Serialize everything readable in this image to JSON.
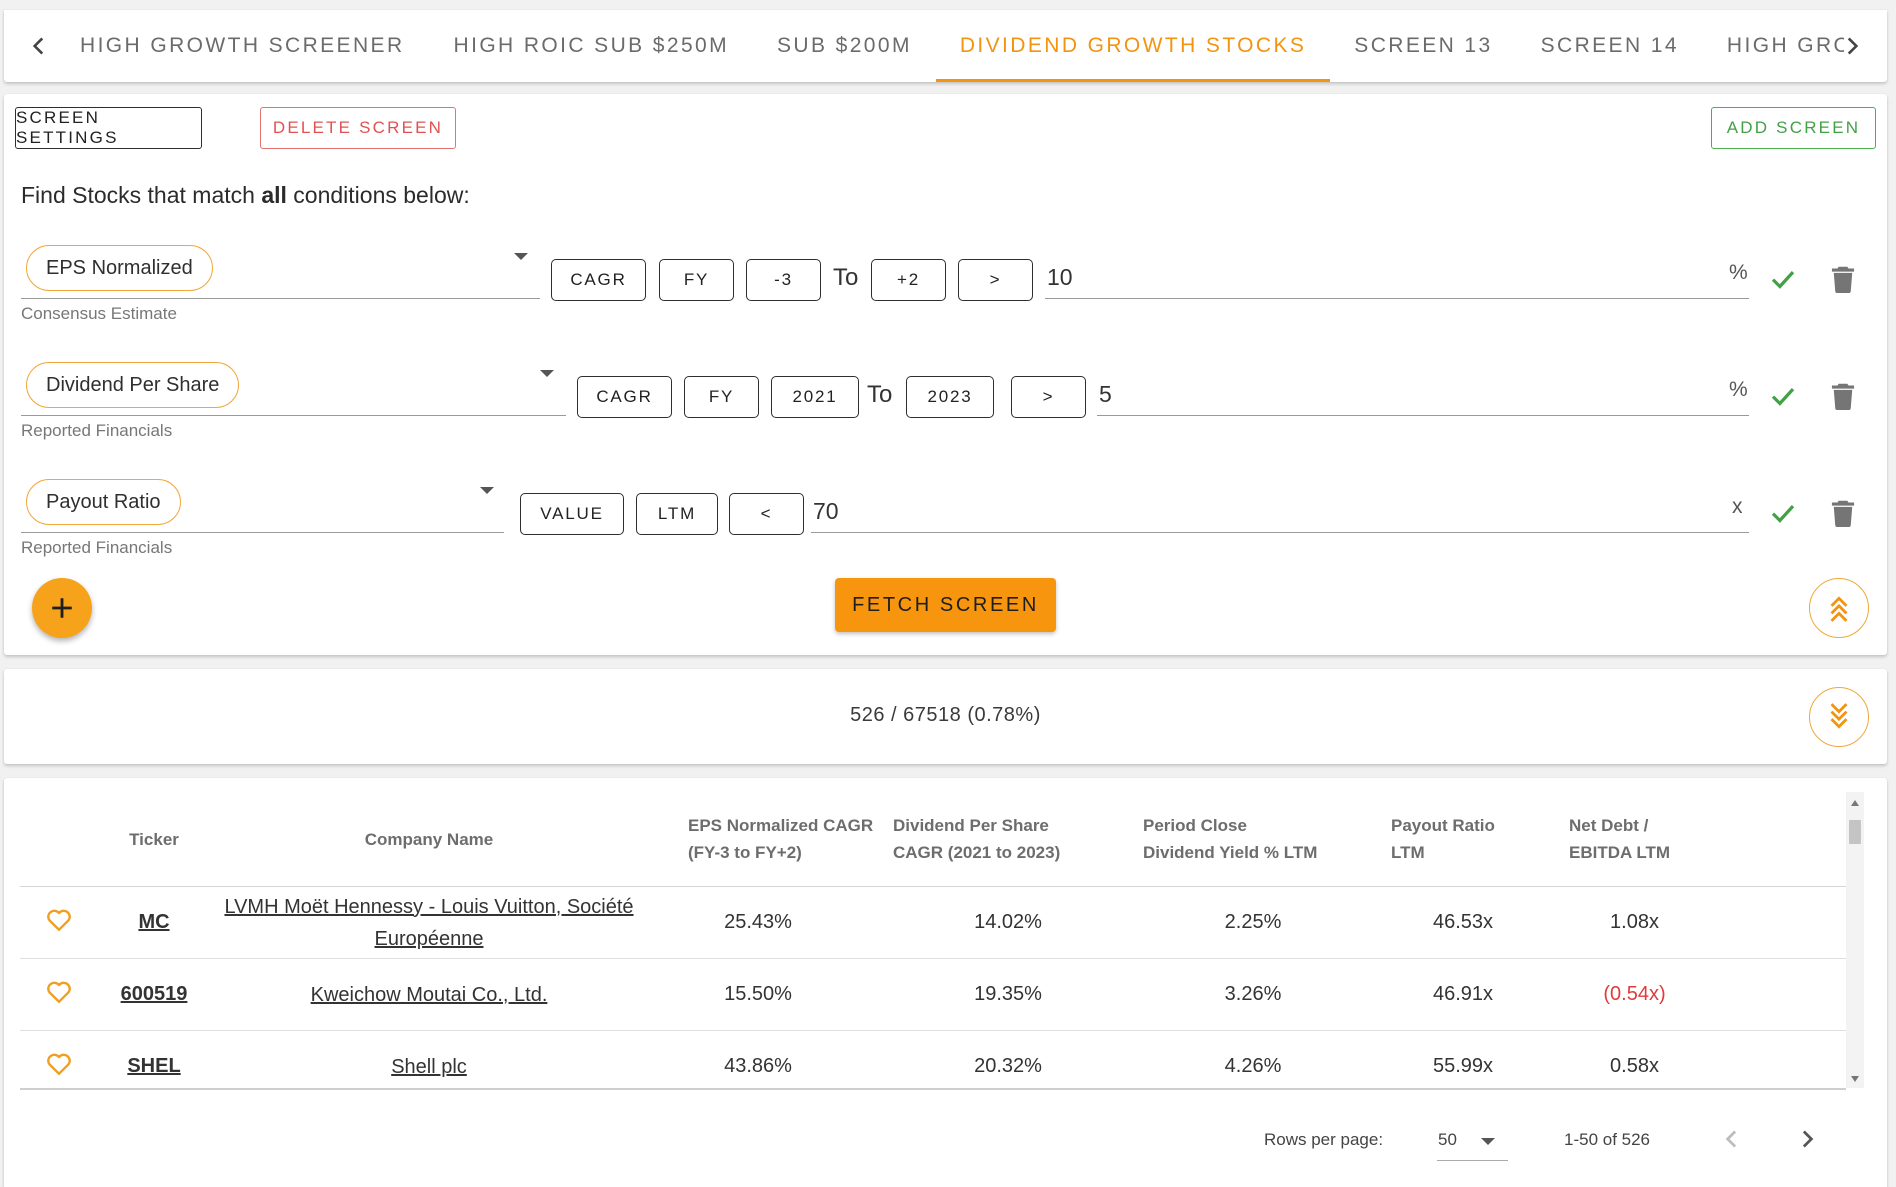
{
  "tabs": {
    "items": [
      "HIGH GROWTH SCREENER",
      "HIGH ROIC SUB $250M",
      "SUB $200M",
      "DIVIDEND GROWTH STOCKS",
      "SCREEN 13",
      "SCREEN 14",
      "HIGH GROSS MARG"
    ],
    "active_index": 3,
    "prev_icon": "chevron-left-icon",
    "next_icon": "chevron-right-icon"
  },
  "toolbar": {
    "settings_label": "SCREEN SETTINGS",
    "delete_label": "DELETE SCREEN",
    "add_label": "ADD SCREEN"
  },
  "instructions": {
    "prefix": "Find Stocks that match ",
    "emphasis": "all",
    "suffix": " conditions below:"
  },
  "conditions": [
    {
      "metric": "EPS Normalized",
      "source": "Consensus Estimate",
      "calc": "CAGR",
      "period_type": "FY",
      "from": "-3",
      "to_label": "To",
      "to": "+2",
      "operator": ">",
      "value": "10",
      "unit": "%"
    },
    {
      "metric": "Dividend Per Share",
      "source": "Reported Financials",
      "calc": "CAGR",
      "period_type": "FY",
      "from": "2021",
      "to_label": "To",
      "to": "2023",
      "operator": ">",
      "value": "5",
      "unit": "%"
    },
    {
      "metric": "Payout Ratio",
      "source": "Reported Financials",
      "calc": "VALUE",
      "period_type": "LTM",
      "operator": "<",
      "value": "70",
      "unit": "x"
    }
  ],
  "actions": {
    "fetch_label": "FETCH SCREEN",
    "add_condition_icon": "plus-icon",
    "collapse_icon": "double-chevron-up-icon",
    "expand_icon": "double-chevron-down-icon"
  },
  "summary": {
    "text": "526 / 67518 (0.78%)"
  },
  "table": {
    "columns": [
      "",
      "Ticker",
      "Company Name",
      "EPS Normalized CAGR (FY-3 to FY+2)",
      "Dividend Per Share CAGR (2021 to 2023)",
      "Period Close Dividend Yield % LTM",
      "Payout Ratio LTM",
      "Net Debt / EBITDA LTM"
    ],
    "column_lines": [
      [],
      [
        "Ticker"
      ],
      [
        "Company Name"
      ],
      [
        "EPS Normalized CAGR",
        "(FY-3 to FY+2)"
      ],
      [
        "Dividend Per Share",
        "CAGR (2021 to 2023)"
      ],
      [
        "Period Close",
        "Dividend Yield % LTM"
      ],
      [
        "Payout Ratio",
        "LTM"
      ],
      [
        "Net Debt /",
        "EBITDA LTM"
      ]
    ],
    "rows": [
      {
        "ticker": "MC",
        "company_lines": [
          "LVMH Moët Hennessy - Louis Vuitton, Société",
          "Européenne"
        ],
        "eps_cagr": "25.43%",
        "dps_cagr": "14.02%",
        "div_yield": "2.25%",
        "payout": "46.53x",
        "net_debt_ebitda": "1.08x",
        "negative": false
      },
      {
        "ticker": "600519",
        "company_lines": [
          "Kweichow Moutai Co., Ltd."
        ],
        "eps_cagr": "15.50%",
        "dps_cagr": "19.35%",
        "div_yield": "3.26%",
        "payout": "46.91x",
        "net_debt_ebitda": "(0.54x)",
        "negative": true
      },
      {
        "ticker": "SHEL",
        "company_lines": [
          "Shell plc"
        ],
        "eps_cagr": "43.86%",
        "dps_cagr": "20.32%",
        "div_yield": "4.26%",
        "payout": "55.99x",
        "net_debt_ebitda": "0.58x",
        "negative": false
      }
    ],
    "favorite_icon": "heart-outline-icon"
  },
  "pagination": {
    "rows_label": "Rows per page:",
    "rows_value": "50",
    "range_text": "1-50 of 526"
  },
  "colors": {
    "accent": "#f29410",
    "success": "#43a047",
    "danger": "#e05252",
    "negative": "#e03c3c"
  }
}
